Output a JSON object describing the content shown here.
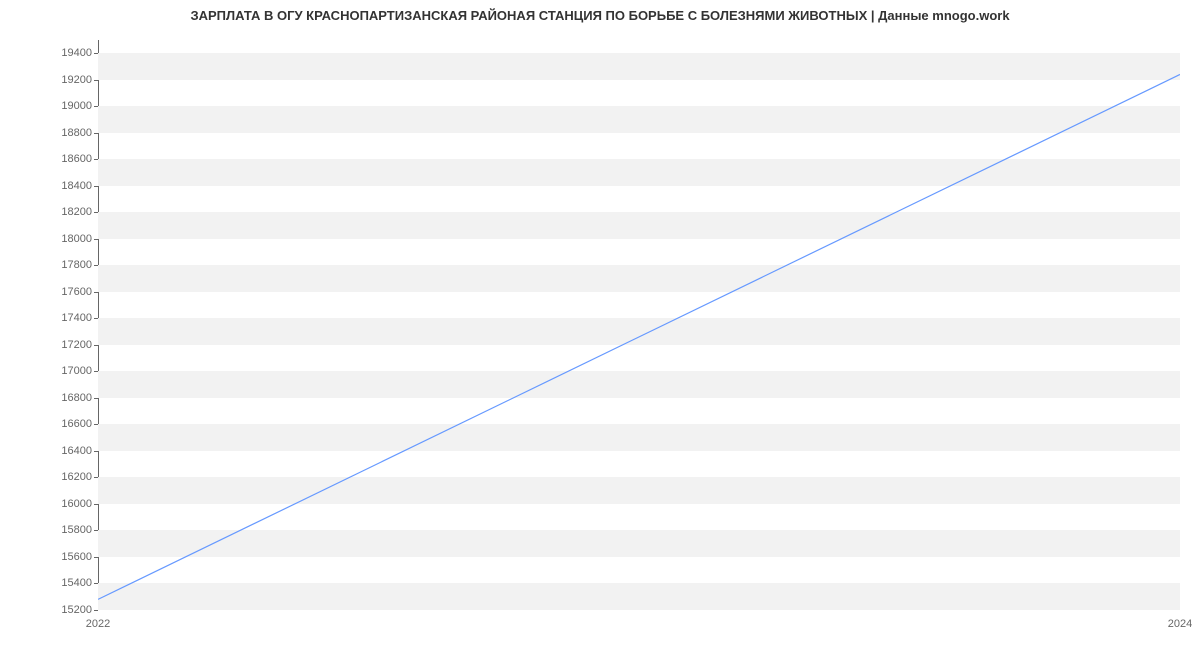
{
  "chart_data": {
    "type": "line",
    "title": "ЗАРПЛАТА В ОГУ КРАСНОПАРТИЗАНСКАЯ РАЙОНАЯ СТАНЦИЯ ПО БОРЬБЕ С БОЛЕЗНЯМИ ЖИВОТНЫХ | Данные mnogo.work",
    "xlabel": "",
    "ylabel": "",
    "x": [
      2022,
      2024
    ],
    "values": [
      15280,
      19240
    ],
    "y_ticks": [
      15200,
      15400,
      15600,
      15800,
      16000,
      16200,
      16400,
      16600,
      16800,
      17000,
      17200,
      17400,
      17600,
      17800,
      18000,
      18200,
      18400,
      18600,
      18800,
      19000,
      19200,
      19400
    ],
    "x_ticks": [
      2022,
      2024
    ],
    "ylim": [
      15200,
      19500
    ],
    "xlim": [
      2022,
      2024
    ],
    "line_color": "#6699ff",
    "grid_on": true
  }
}
